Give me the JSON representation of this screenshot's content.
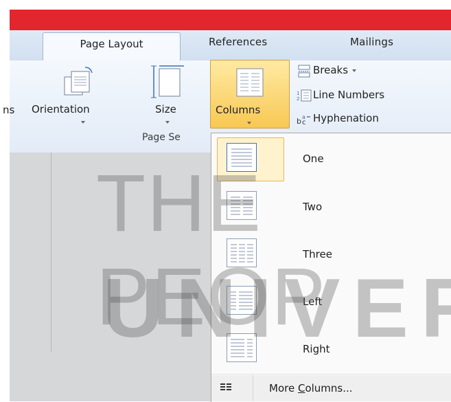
{
  "tabs": [
    {
      "label": "Page Layout",
      "active": true
    },
    {
      "label": "References"
    },
    {
      "label": "Mailings"
    }
  ],
  "ribbon": {
    "partial_left": "ns",
    "orientation": "Orientation",
    "size": "Size",
    "columns": "Columns",
    "breaks": "Breaks",
    "line_numbers": "Line Numbers",
    "hyphenation": "Hyphenation",
    "group_label": "Page Se"
  },
  "menu": {
    "items": [
      {
        "label": "One",
        "icon": "one-column-icon",
        "selected": true
      },
      {
        "label": "Two",
        "icon": "two-column-icon"
      },
      {
        "label": "Three",
        "icon": "three-column-icon"
      },
      {
        "label": "Left",
        "icon": "left-column-icon"
      },
      {
        "label": "Right",
        "icon": "right-column-icon"
      }
    ],
    "more_prefix": "More ",
    "more_underlined": "C",
    "more_suffix": "olumns..."
  },
  "watermark": {
    "line1": "THE PEOP",
    "line2": "UNIVERS"
  },
  "colors": {
    "accent": "#e3262d",
    "selection": "#f8c853"
  }
}
